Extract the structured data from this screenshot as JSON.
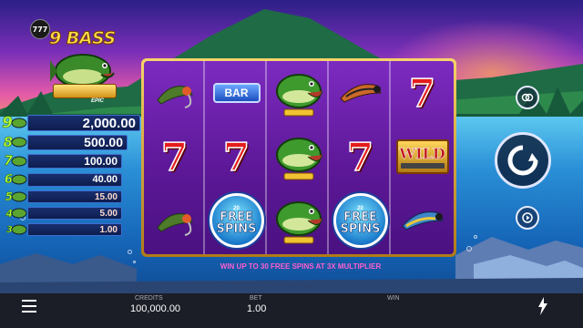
{
  "game": {
    "logo_badge": "777",
    "logo_title": "9 BASS",
    "logo_sub": "EPIC"
  },
  "paytable": [
    {
      "count": "9",
      "payout": "2,000.00"
    },
    {
      "count": "8",
      "payout": "500.00"
    },
    {
      "count": "7",
      "payout": "100.00"
    },
    {
      "count": "6",
      "payout": "40.00"
    },
    {
      "count": "5",
      "payout": "15.00"
    },
    {
      "count": "4",
      "payout": "5.00"
    },
    {
      "count": "3",
      "payout": "1.00"
    }
  ],
  "reels": [
    [
      "fly-lure",
      "seven",
      "fly-lure"
    ],
    [
      "bar",
      "seven",
      "free-spins"
    ],
    [
      "bass",
      "bass",
      "bass"
    ],
    [
      "fly-lure",
      "seven",
      "free-spins"
    ],
    [
      "seven",
      "wild",
      "fly-lure"
    ]
  ],
  "symbols": {
    "bar_label": "BAR",
    "seven_label": "7",
    "wild_label": "WILD",
    "free_spins_top": "20",
    "free_spins_line1": "FREE",
    "free_spins_line2": "SPINS"
  },
  "promo_text": "WIN UP TO 30 FREE SPINS AT 3X MULTIPLIER",
  "bottom_bar": {
    "credits_label": "CREDITS",
    "credits_value": "100,000.00",
    "bet_label": "BET",
    "bet_value": "1.00",
    "win_label": "WIN",
    "win_value": ""
  },
  "controls": {
    "autoplay_icon": "autoplay-icon",
    "spin_icon": "spin-icon",
    "turbo_icon": "turbo-icon",
    "menu_icon": "menu-icon",
    "bolt_icon": "lightning-icon"
  },
  "colors": {
    "reel_bg": "#6a1fa8",
    "frame_gold": "#e2b44a",
    "paytable_bar": "#14265c",
    "promo_pink": "#ff5fcf",
    "bottom_bar": "#1b1e27"
  }
}
